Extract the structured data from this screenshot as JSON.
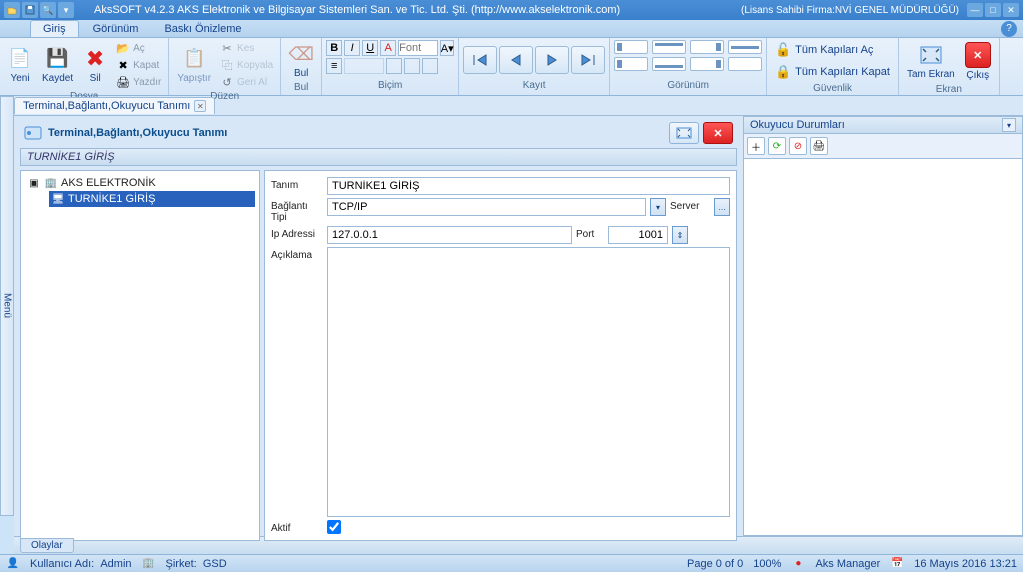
{
  "app": {
    "title": "AksSOFT v4.2.3 AKS Elektronik ve Bilgisayar Sistemleri San. ve Tic. Ltd. Şti. (http://www.akselektronik.com)",
    "license": "(Lisans Sahibi Firma:NVİ GENEL MÜDÜRLÜĞÜ)"
  },
  "tabs": {
    "giris": "Giriş",
    "gorunum": "Görünüm",
    "baski": "Baskı Önizleme"
  },
  "ribbon": {
    "dosya": {
      "label": "Dosya",
      "yeni": "Yeni",
      "kaydet": "Kaydet",
      "sil": "Sil",
      "ac": "Aç",
      "kapat": "Kapat",
      "yazdir": "Yazdır"
    },
    "duzen": {
      "label": "Düzen",
      "yapistir": "Yapıştır",
      "kes": "Kes",
      "kopyala": "Kopyala",
      "gerial": "Geri Al"
    },
    "bul": {
      "label": "Bul",
      "bul": "Bul"
    },
    "bicim": {
      "label": "Biçim",
      "font_placeholder": "Font"
    },
    "kayit": {
      "label": "Kayıt"
    },
    "gorunum": {
      "label": "Görünüm"
    },
    "guvenlik": {
      "label": "Güvenlik",
      "kapilari_ac": "Tüm Kapıları Aç",
      "kapilari_kapat": "Tüm Kapıları Kapat"
    },
    "ekran": {
      "label": "Ekran",
      "tam_ekran": "Tam Ekran",
      "cikis": "Çıkış"
    }
  },
  "sidebar": {
    "menu": "Menü"
  },
  "doctab": {
    "title": "Terminal,Bağlantı,Okuyucu Tanımı"
  },
  "doc": {
    "title": "Terminal,Bağlantı,Okuyucu Tanımı",
    "subheader": "TURNİKE1 GİRİŞ",
    "tree": {
      "root": "AKS ELEKTRONİK",
      "child": "TURNİKE1 GİRİŞ"
    },
    "form": {
      "tanim_lbl": "Tanım",
      "tanim_val": "TURNİKE1 GİRİŞ",
      "baglanti_lbl": "Bağlantı Tipi",
      "baglanti_val": "TCP/IP",
      "server_lbl": "Server",
      "ip_lbl": "Ip Adressi",
      "ip_val": "127.0.0.1",
      "port_lbl": "Port",
      "port_val": "1001",
      "aciklama_lbl": "Açıklama",
      "aciklama_val": "",
      "aktif_lbl": "Aktif"
    }
  },
  "right": {
    "title": "Okuyucu Durumları"
  },
  "bottom": {
    "olaylar": "Olaylar"
  },
  "status": {
    "user_lbl": "Kullanıcı Adı:",
    "user_val": "Admin",
    "sirket_lbl": "Şirket:",
    "sirket_val": "GSD",
    "page": "Page 0 of 0",
    "zoom": "100%",
    "manager": "Aks Manager",
    "datetime": "16 Mayıs 2016 13:21"
  }
}
